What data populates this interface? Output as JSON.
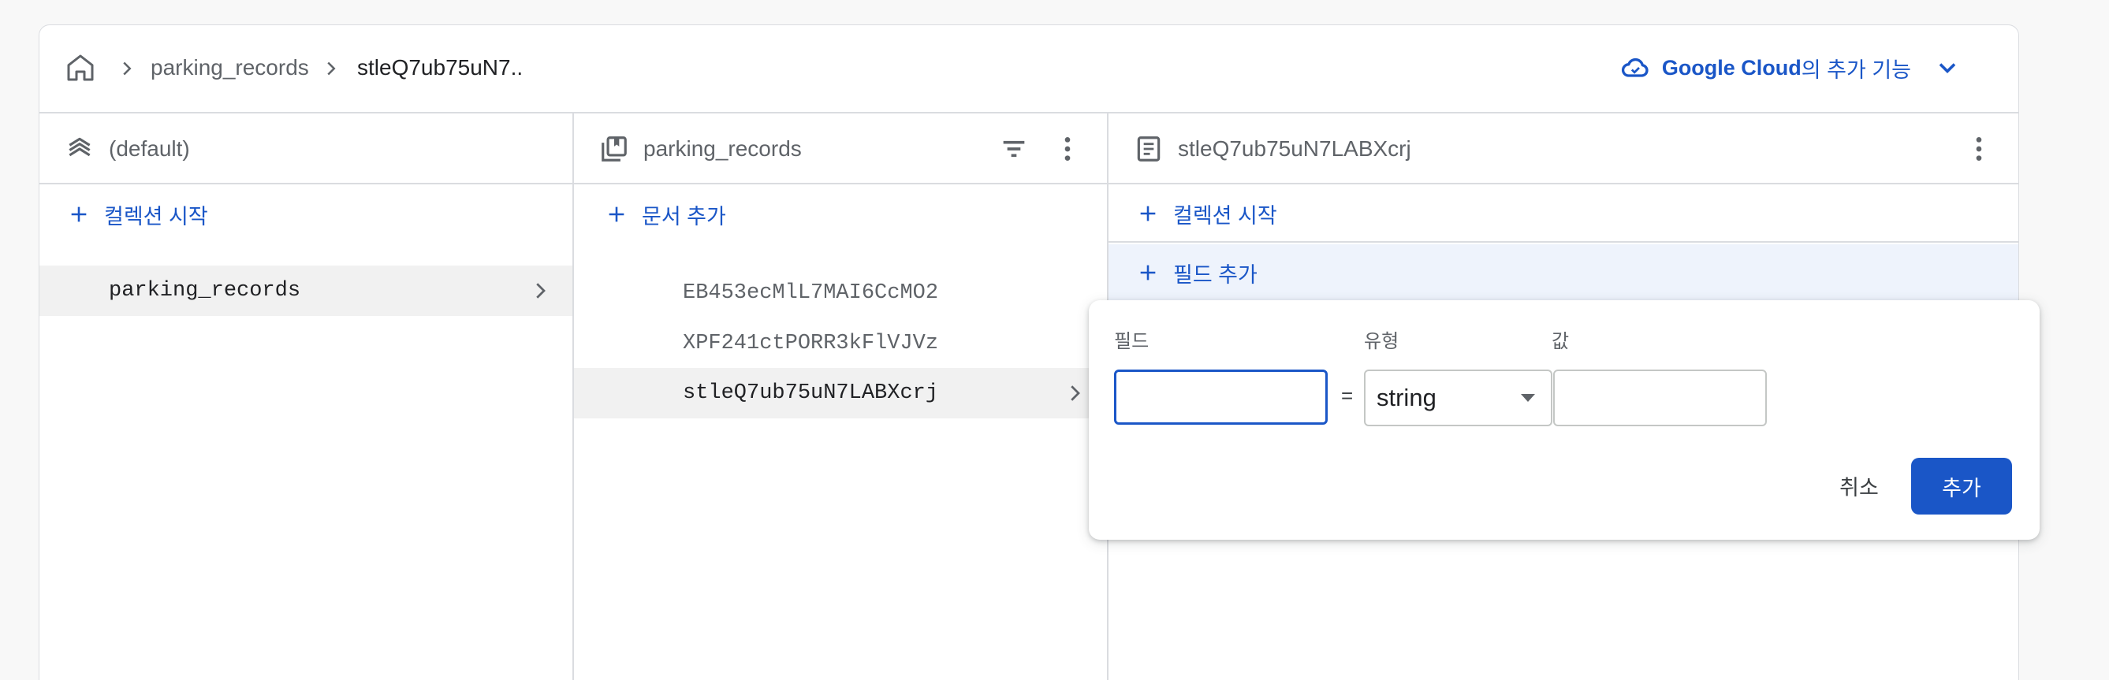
{
  "breadcrumb": {
    "items": [
      "parking_records",
      "stleQ7ub75uN7.."
    ]
  },
  "header": {
    "addon_brand": "Google Cloud",
    "addon_suffix": "의 추가 기능"
  },
  "columns": {
    "database": {
      "title": "(default)",
      "add_label": "컬렉션 시작",
      "items": [
        "parking_records"
      ]
    },
    "collection": {
      "title": "parking_records",
      "add_label": "문서 추가",
      "items": [
        "EB453ecMlL7MAI6CcMO2",
        "XPF241ctPORR3kFlVJVz",
        "stleQ7ub75uN7LABXcrj"
      ]
    },
    "document": {
      "title": "stleQ7ub75uN7LABXcrj",
      "add_collection_label": "컬렉션 시작",
      "add_field_label": "필드 추가"
    }
  },
  "field_form": {
    "field_label": "필드",
    "type_label": "유형",
    "value_label": "값",
    "field_value": "",
    "equals": "=",
    "type_selected": "string",
    "value_value": "",
    "cancel_label": "취소",
    "add_label": "추가"
  },
  "colors": {
    "accent": "#1a56c7",
    "border": "#dadce0",
    "selected_bg": "#f1f1f1",
    "field_row_bg": "#eef3fc"
  },
  "icons": {
    "home": "home-icon",
    "database": "database-stack-icon",
    "collection": "collection-icon",
    "document": "document-icon",
    "filter": "filter-icon",
    "more": "more-vert-icon",
    "add": "plus-icon",
    "chevron": "chevron-right-icon",
    "cloud": "cloud-icon",
    "dropdown": "chevron-down-icon"
  }
}
